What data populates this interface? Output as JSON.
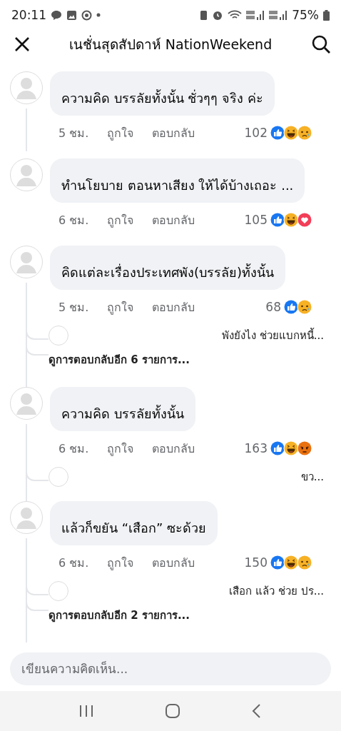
{
  "status_bar": {
    "time": "20:11",
    "battery": "75%"
  },
  "header": {
    "title": "เนชั่นสุดสัปดาห์ NationWeekend"
  },
  "comments": [
    {
      "text": "ความคิด บรรลัยทั้งนั้น ชั่วๆๆ จริง ค่ะ",
      "time": "5 ชม.",
      "like": "ถูกใจ",
      "reply": "ตอบกลับ",
      "count": "102",
      "reactions": [
        {
          "kind": "like"
        },
        {
          "kind": "haha"
        },
        {
          "kind": "sad"
        }
      ],
      "thread_line": true
    },
    {
      "text": "ทำนโยบาย ตอนหาเสียง ให้ได้บ้างเถอะ ...",
      "time": "6 ชม.",
      "like": "ถูกใจ",
      "reply": "ตอบกลับ",
      "count": "105",
      "reactions": [
        {
          "kind": "like"
        },
        {
          "kind": "haha"
        },
        {
          "kind": "love"
        }
      ],
      "thread_line": false
    },
    {
      "text": "คิดแต่ละเรื่องประเทศพัง(บรรลัย)ทั้งนั้น",
      "time": "5 ชม.",
      "like": "ถูกใจ",
      "reply": "ตอบกลับ",
      "count": "68",
      "reactions": [
        {
          "kind": "like"
        },
        {
          "kind": "sad"
        }
      ],
      "thread_line": true,
      "replies": [
        {
          "text": "พังยังไง ช่วยแบกหนี้..."
        }
      ],
      "more": "ดูการตอบกลับอีก 6 รายการ..."
    },
    {
      "text": "ความคิด บรรลัยทั้งนั้น",
      "time": "6 ชม.",
      "like": "ถูกใจ",
      "reply": "ตอบกลับ",
      "count": "163",
      "reactions": [
        {
          "kind": "like"
        },
        {
          "kind": "haha"
        },
        {
          "kind": "angry"
        }
      ],
      "thread_line": true,
      "replies": [
        {
          "text": "ขว..."
        }
      ]
    },
    {
      "text": "แล้วก็ขยัน “เสือก” ซะด้วย",
      "time": "6 ชม.",
      "like": "ถูกใจ",
      "reply": "ตอบกลับ",
      "count": "150",
      "reactions": [
        {
          "kind": "like"
        },
        {
          "kind": "haha"
        },
        {
          "kind": "sad"
        }
      ],
      "thread_line": true,
      "replies": [
        {
          "text": "เสือก แล้ว ช่วย ปร..."
        }
      ],
      "more": "ดูการตอบกลับอีก 2 รายการ..."
    }
  ],
  "composer": {
    "placeholder": "เขียนความคิดเห็น..."
  }
}
